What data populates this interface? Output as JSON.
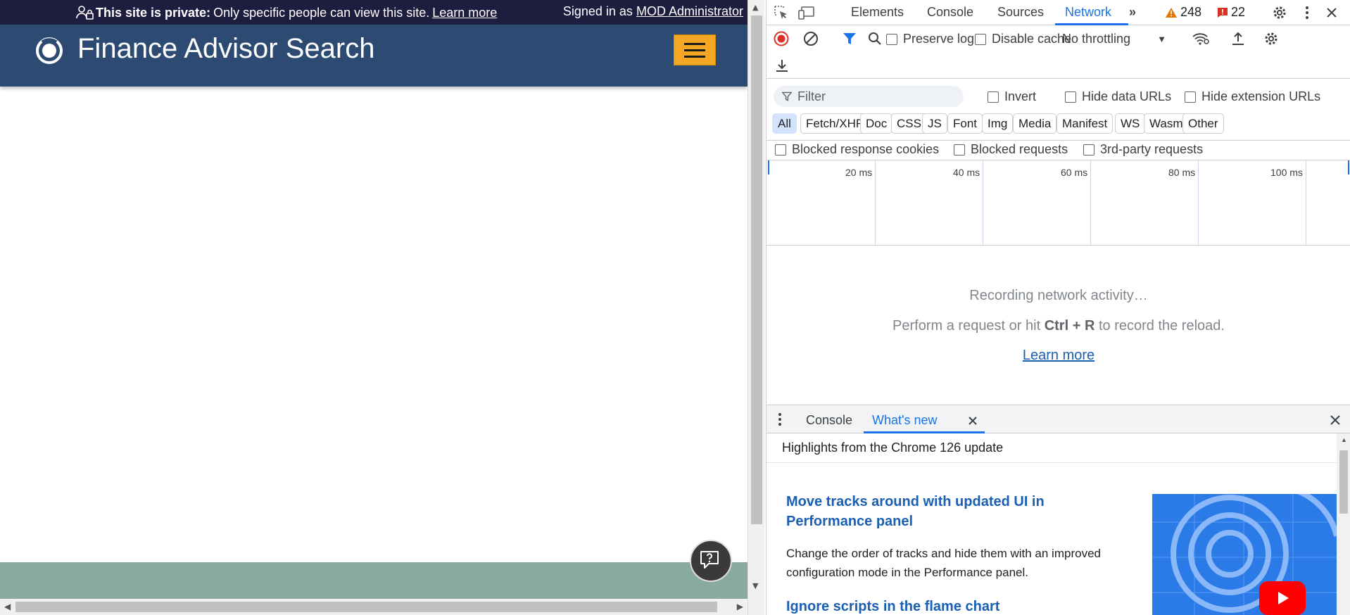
{
  "site": {
    "privacy_bold": "This site is private:",
    "privacy_text": "Only specific people can view this site.",
    "privacy_link": "Learn more",
    "signed_in_prefix": "Signed in as",
    "signed_in_user": "MOD Administrator",
    "title": "Finance Advisor Search",
    "colors": {
      "privacy_bar": "#1f1d3f",
      "header": "#2c4a72",
      "menu_button": "#f5a623",
      "footer": "#89aaa0"
    }
  },
  "devtools": {
    "tabs": [
      "Elements",
      "Console",
      "Sources",
      "Network"
    ],
    "active_tab": "Network",
    "warnings_count": "248",
    "errors_count": "22",
    "toolbar": {
      "preserve_log": "Preserve log",
      "disable_cache": "Disable cache",
      "throttling": "No throttling"
    },
    "filter": {
      "placeholder": "Filter",
      "invert": "Invert",
      "hide_data_urls": "Hide data URLs",
      "hide_extension_urls": "Hide extension URLs"
    },
    "type_chips": [
      "All",
      "Fetch/XHR",
      "Doc",
      "CSS",
      "JS",
      "Font",
      "Img",
      "Media",
      "Manifest",
      "WS",
      "Wasm",
      "Other"
    ],
    "active_chip": "All",
    "block_filters": {
      "blocked_cookies": "Blocked response cookies",
      "blocked_requests": "Blocked requests",
      "third_party": "3rd-party requests"
    },
    "timeline_ticks": [
      "20 ms",
      "40 ms",
      "60 ms",
      "80 ms",
      "100 ms"
    ],
    "empty": {
      "recording": "Recording network activity…",
      "hint_prefix": "Perform a request or hit",
      "hint_keys": "Ctrl + R",
      "hint_suffix": "to record the reload.",
      "learn_more": "Learn more"
    },
    "drawer": {
      "tabs": [
        "Console",
        "What's new"
      ],
      "active_tab": "What's new",
      "highlights": "Highlights from the Chrome 126 update",
      "features": [
        {
          "title": "Move tracks around with updated UI in Performance panel",
          "desc": "Change the order of tracks and hide them with an improved configuration mode in the Performance panel."
        },
        {
          "title": "Ignore scripts in the flame chart",
          "desc": ""
        }
      ]
    }
  }
}
